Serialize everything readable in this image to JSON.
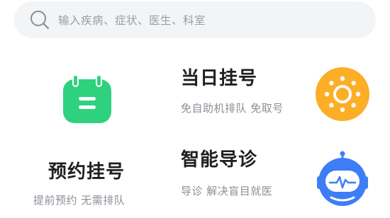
{
  "search": {
    "placeholder": "输入疾病、症状、医生、科室"
  },
  "appointment": {
    "title": "预约挂号",
    "subtitle": "提前预约 无需排队",
    "icon": "calendar-icon",
    "color": "#2fd17f"
  },
  "same_day": {
    "title": "当日挂号",
    "subtitle": "免自助机排队 免取号",
    "icon": "sun-icon",
    "color": "#fcae27"
  },
  "smart_guide": {
    "title": "智能导诊",
    "subtitle": "导诊 解决盲目就医",
    "icon": "robot-icon",
    "color": "#3d7ef7"
  }
}
